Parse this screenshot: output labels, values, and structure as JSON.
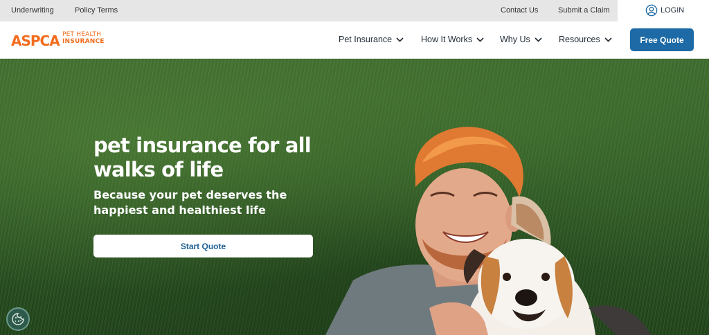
{
  "utility": {
    "underwriting": "Underwriting",
    "policy_terms": "Policy Terms",
    "contact_us": "Contact Us",
    "submit_claim": "Submit a Claim",
    "login": "LOGIN"
  },
  "brand": {
    "logo_main": "ASPCA",
    "logo_line1": "PET HEALTH",
    "logo_line2": "INSURANCE"
  },
  "nav": {
    "items": [
      "Pet Insurance",
      "How It Works",
      "Why Us",
      "Resources"
    ],
    "cta": "Free Quote"
  },
  "hero": {
    "heading": "pet insurance for all walks of life",
    "subheading": "Because your pet deserves the happiest and healthiest life",
    "cta": "Start Quote"
  },
  "icons": {
    "login": "user-circle-icon",
    "nav_dropdown": "chevron-down-icon",
    "cookie": "cookie-icon"
  },
  "colors": {
    "brand_orange": "#f26c1e",
    "primary_blue": "#1d6aa6",
    "grass_green": "#2f5a26"
  }
}
